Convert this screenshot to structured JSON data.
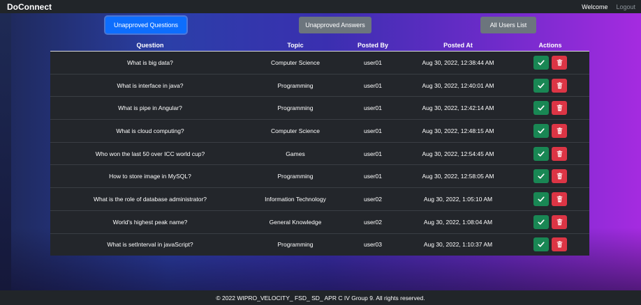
{
  "navbar": {
    "brand": "DoConnect",
    "welcome": "Welcome",
    "logout": "Logout"
  },
  "tabs": {
    "unapproved_questions": "Unapproved Questions",
    "unapproved_answers": "Unapproved Answers",
    "all_users": "All Users List"
  },
  "table": {
    "headers": [
      "Question",
      "Topic",
      "Posted By",
      "Posted At",
      "Actions"
    ],
    "rows": [
      {
        "question": "What is big data?",
        "topic": "Computer Science",
        "posted_by": "user01",
        "posted_at": "Aug 30, 2022, 12:38:44 AM"
      },
      {
        "question": "What is interface in java?",
        "topic": "Programming",
        "posted_by": "user01",
        "posted_at": "Aug 30, 2022, 12:40:01 AM"
      },
      {
        "question": "What is pipe in Angular?",
        "topic": "Programming",
        "posted_by": "user01",
        "posted_at": "Aug 30, 2022, 12:42:14 AM"
      },
      {
        "question": "What is cloud computing?",
        "topic": "Computer Science",
        "posted_by": "user01",
        "posted_at": "Aug 30, 2022, 12:48:15 AM"
      },
      {
        "question": "Who won the last 50 over ICC world cup?",
        "topic": "Games",
        "posted_by": "user01",
        "posted_at": "Aug 30, 2022, 12:54:45 AM"
      },
      {
        "question": "How to store image in MySQL?",
        "topic": "Programming",
        "posted_by": "user01",
        "posted_at": "Aug 30, 2022, 12:58:05 AM"
      },
      {
        "question": "What is the role of database administrator?",
        "topic": "Information Technology",
        "posted_by": "user02",
        "posted_at": "Aug 30, 2022, 1:05:10 AM"
      },
      {
        "question": "World's highest peak name?",
        "topic": "General Knowledge",
        "posted_by": "user02",
        "posted_at": "Aug 30, 2022, 1:08:04 AM"
      },
      {
        "question": "What is setInterval in javaScript?",
        "topic": "Programming",
        "posted_by": "user03",
        "posted_at": "Aug 30, 2022, 1:10:37 AM"
      }
    ]
  },
  "footer": {
    "text": "© 2022 WIPRO_VELOCITY_ FSD_ SD_ APR C IV Group 9. All rights reserved."
  },
  "colors": {
    "primary": "#0d6efd",
    "secondary": "#6c757d",
    "success": "#198754",
    "danger": "#dc3545"
  },
  "icons": {
    "approve": "check-icon",
    "delete": "trash-icon"
  }
}
